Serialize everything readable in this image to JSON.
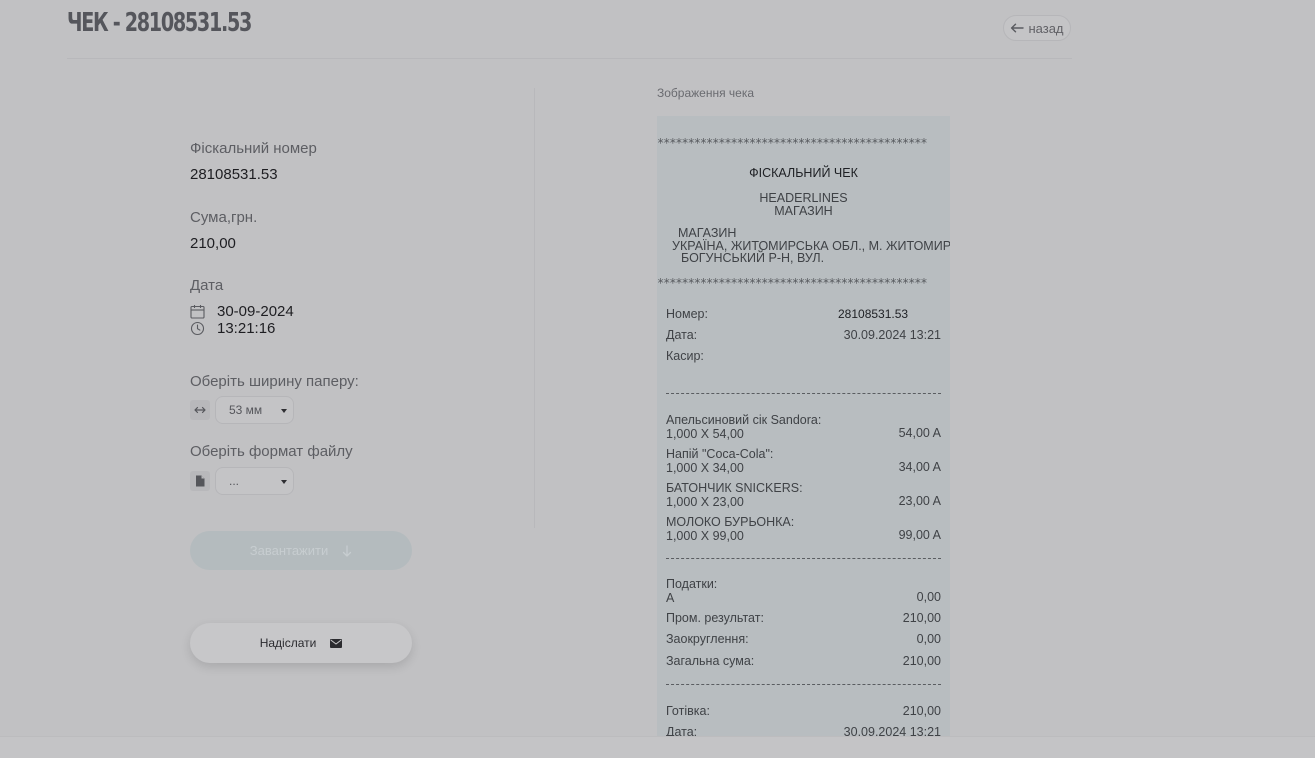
{
  "header": {
    "title": "ЧЕК - 28108531.53",
    "back_label": "назад"
  },
  "details": {
    "fiscal_label": "Фіскальний номер",
    "fiscal_value": "28108531.53",
    "sum_label": "Сума,грн.",
    "sum_value": "210,00",
    "date_label": "Дата",
    "date_value": "30-09-2024",
    "time_value": "13:21:16",
    "paper_width_label": "Оберіть ширину паперу:",
    "paper_width_value": "53 мм",
    "file_format_label": "Оберіть формат файлу",
    "file_format_value": "...",
    "download_label": "Завантажити",
    "send_label": "Надіслати"
  },
  "receipt": {
    "caption": "Зображення чека",
    "stars": "********************************************",
    "title": "ФІСКАЛЬНИЙ ЧЕК",
    "header_line1": "HEADERLINES",
    "header_line2": "МАГАЗИН",
    "shop_name": "МАГАЗИН",
    "address1": "УКРАЇНА, ЖИТОМИРСЬКА ОБЛ., М. ЖИТОМИР",
    "address2": "БОГУНСЬКИЙ Р-Н, ВУЛ.",
    "number_label": "Номер:",
    "number_value": "28108531.53",
    "date_label": "Дата:",
    "date_value": "30.09.2024 13:21",
    "cashier_label": "Касир:",
    "items": [
      {
        "name": "Апельсиновий сік Sandora:",
        "qty": "1,000 X 54,00",
        "sum": "54,00 A"
      },
      {
        "name": "Напій \"Coca-Cola\":",
        "qty": "1,000 X 34,00",
        "sum": "34,00 A"
      },
      {
        "name": "БАТОНЧИК SNICKERS:",
        "qty": "1,000 X 23,00",
        "sum": "23,00 A"
      },
      {
        "name": "МОЛОКО БУРЬОНКА:",
        "qty": "1,000 X 99,00",
        "sum": "99,00 A"
      }
    ],
    "taxes_label": "Податки:",
    "tax_a_label": "A",
    "tax_a_value": "0,00",
    "subtotal_label": "Пром. результат:",
    "subtotal_value": "210,00",
    "rounding_label": "Заокруглення:",
    "rounding_value": "0,00",
    "total_label": "Загальна сума:",
    "total_value": "210,00",
    "cash_label": "Готівка:",
    "cash_value": "210,00",
    "date2_label": "Дата:",
    "date2_value": "30.09.2024 13:21"
  }
}
